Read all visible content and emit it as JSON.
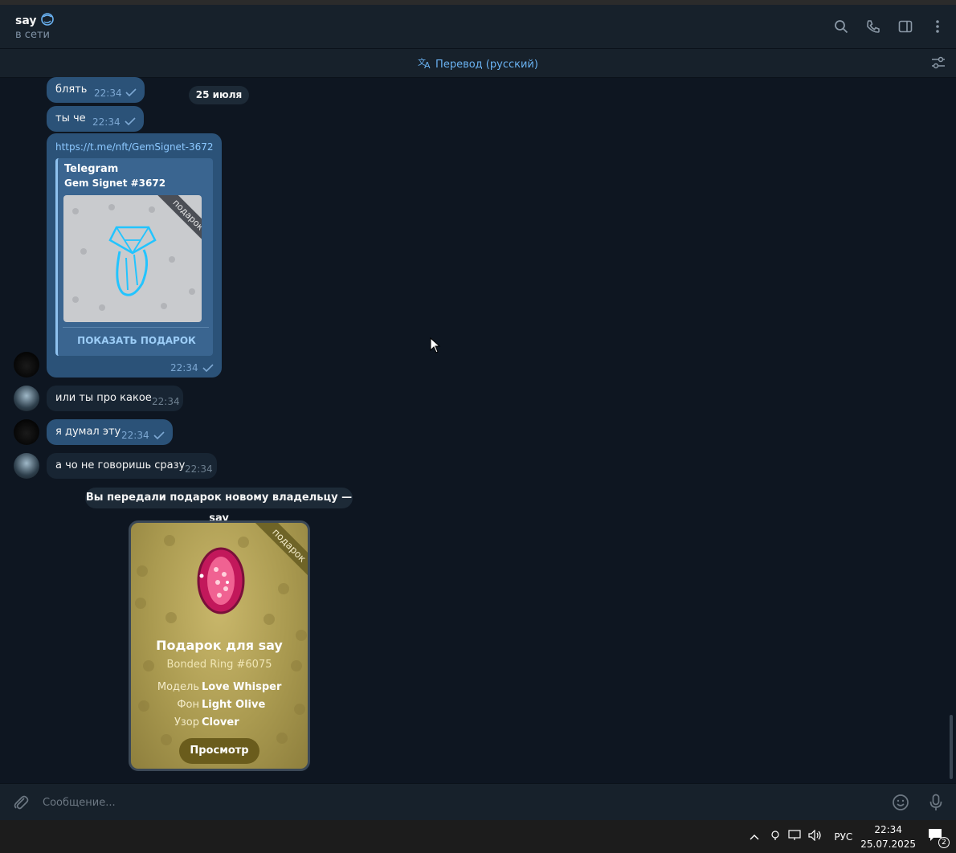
{
  "header": {
    "name": "say",
    "status": "в сети"
  },
  "translate_bar": {
    "label": "Перевод (русский)"
  },
  "date_pill": "25 июля",
  "messages": [
    {
      "text": "блять",
      "time": "22:34"
    },
    {
      "text": "ты че",
      "time": "22:34"
    },
    {
      "link": "https://t.me/nft/GemSignet-3672",
      "site": "Telegram",
      "title": "Gem Signet #3672",
      "badge": "подарок",
      "button": "ПОКАЗАТЬ ПОДАРОК",
      "time": "22:34"
    },
    {
      "text": "или ты про какое",
      "time": "22:34"
    },
    {
      "text": "я думал эту",
      "time": "22:34"
    },
    {
      "text": "а чо не говоришь сразу",
      "time": "22:34"
    }
  ],
  "service": {
    "text": "Вы передали подарок новому владельцу — say"
  },
  "gift": {
    "badge": "подарок",
    "title": "Подарок для say",
    "subtitle": "Bonded Ring #6075",
    "attributes": [
      {
        "key": "Модель",
        "value": "Love Whisper"
      },
      {
        "key": "Фон",
        "value": "Light Olive"
      },
      {
        "key": "Узор",
        "value": "Clover"
      }
    ],
    "button": "Просмотр"
  },
  "composer": {
    "placeholder": "Сообщение..."
  },
  "taskbar": {
    "lang": "РУС",
    "time": "22:34",
    "date": "25.07.2025",
    "notifications": "2"
  },
  "colors": {
    "accent": "#6ab2f2",
    "outgoing_bubble": "#2b5278",
    "incoming_bubble": "#182533",
    "background": "#0e1621"
  }
}
